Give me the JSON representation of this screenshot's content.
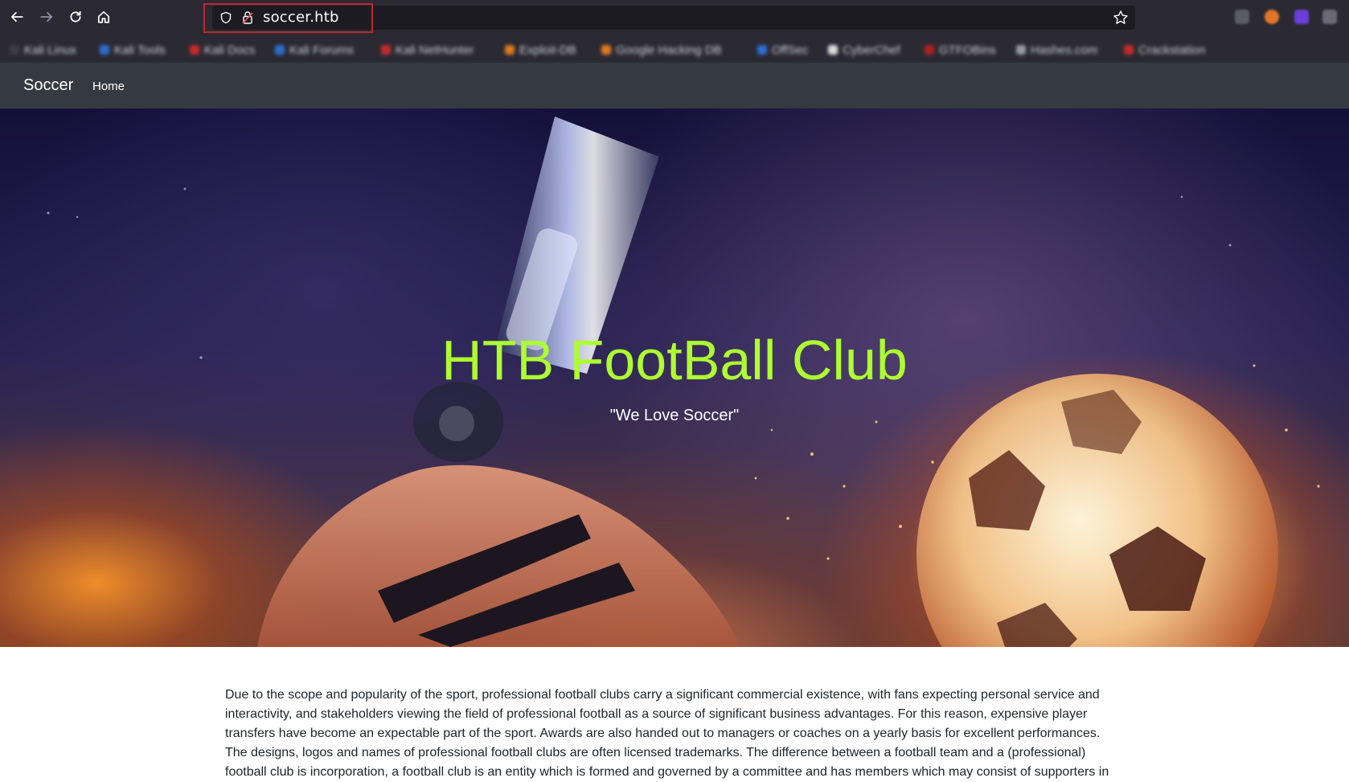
{
  "browser": {
    "url": "soccer.htb",
    "nav_icons": [
      "back-icon",
      "forward-icon",
      "reload-icon",
      "home-icon"
    ],
    "bookmarks": [
      "Kali Linux",
      "Kali Tools",
      "Kali Docs",
      "Kali Forums",
      "Kali NetHunter",
      "Exploit-DB",
      "Google Hacking DB",
      "OffSec",
      "CyberChef",
      "GTFOBins",
      "Hashes.com",
      "Crackstation"
    ],
    "highlight_color": "#c0262c"
  },
  "site": {
    "brand": "Soccer",
    "nav_home": "Home",
    "hero_title": "HTB FootBall Club",
    "hero_subtitle": "\"We Love Soccer\"",
    "title_color": "#adff2f",
    "paragraph": "Due to the scope and popularity of the sport, professional football clubs carry a significant commercial existence, with fans expecting personal service and interactivity, and stakeholders viewing the field of professional football as a source of significant business advantages. For this reason, expensive player transfers have become an expectable part of the sport. Awards are also handed out to managers or coaches on a yearly basis for excellent performances. The designs, logos and names of professional football clubs are often licensed trademarks. The difference between a football team and a (professional) football club is incorporation, a football club is an entity which is formed and governed by a committee and has members which may consist of supporters in"
  }
}
